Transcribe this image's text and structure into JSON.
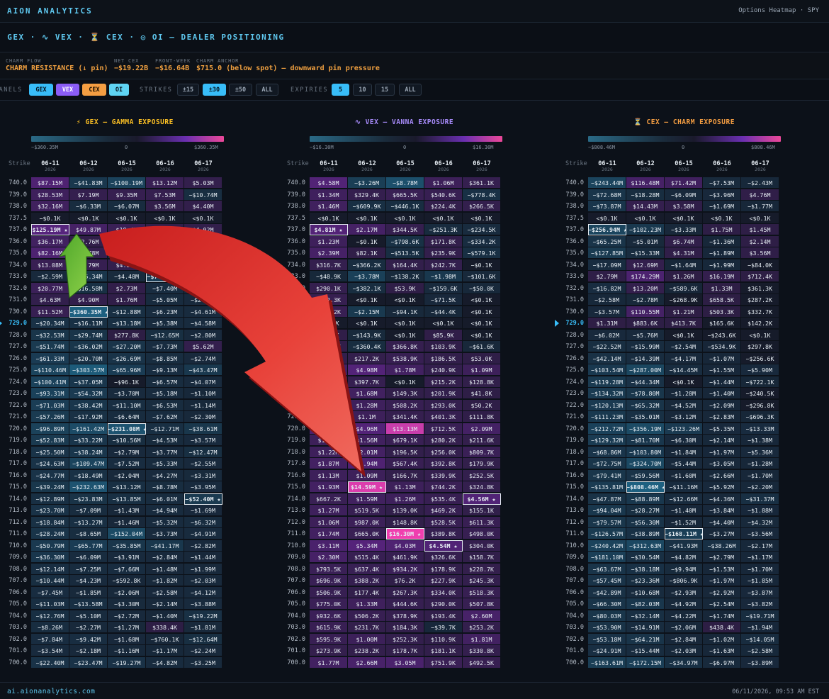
{
  "header": {
    "brand": "AION ANALYTICS",
    "right_label": "Options Heatmap · SPY"
  },
  "title": "⚡ GEX · ∿ VEX · ⏳ CEX · ◎ OI — DEALER POSITIONING",
  "stats": [
    {
      "label": "CHARM FLOW",
      "value": "CHARM RESISTANCE (↓ pin)"
    },
    {
      "label": "NET CEX",
      "value": "−$19.22B"
    },
    {
      "label": "FRONT-WEEK",
      "value": "−$16.64B"
    },
    {
      "label": "CHARM ANCHOR",
      "value": "$715.0 (below spot) — downward pin pressure"
    }
  ],
  "controls": {
    "panels_label": "PANELS",
    "panels": [
      "GEX",
      "VEX",
      "CEX",
      "OI"
    ],
    "strikes_label": "STRIKES",
    "strikes": [
      "±15",
      "±30",
      "±50",
      "ALL"
    ],
    "strikes_selected": "±30",
    "expiries_label": "EXPIRIES",
    "expiries": [
      "5",
      "10",
      "15",
      "ALL"
    ],
    "expiries_selected": "5"
  },
  "colors": {
    "accent": "#38bdf8",
    "gex_title": "#fbbf24",
    "vex_title": "#a78bfa",
    "cex_title": "#f59e42",
    "negative": "#2a5c78",
    "positive": "#7c2fbf",
    "extreme_positive": "#ec4899"
  },
  "dates": [
    {
      "d": "06-11",
      "y": "2026"
    },
    {
      "d": "06-12",
      "y": "2026"
    },
    {
      "d": "06-15",
      "y": "2026"
    },
    {
      "d": "06-16",
      "y": "2026"
    },
    {
      "d": "06-17",
      "y": "2026"
    }
  ],
  "strike_header": "Strike",
  "spot_strike": "729.0",
  "strikes": [
    "740.0",
    "739.0",
    "738.0",
    "737.5",
    "737.0",
    "736.0",
    "735.0",
    "734.0",
    "733.0",
    "732.0",
    "731.0",
    "730.0",
    "729.0",
    "728.0",
    "727.0",
    "726.0",
    "725.0",
    "724.0",
    "723.0",
    "722.0",
    "721.0",
    "720.0",
    "719.0",
    "718.0",
    "717.0",
    "716.0",
    "715.0",
    "714.0",
    "713.0",
    "712.0",
    "711.0",
    "710.0",
    "709.0",
    "708.0",
    "707.0",
    "706.0",
    "705.0",
    "704.0",
    "703.0",
    "702.0",
    "701.0",
    "700.0"
  ],
  "panels": [
    {
      "title": "⚡ GEX — GAMMA EXPOSURE",
      "scale_min": "−$360.35M",
      "scale_mid": "0",
      "scale_max": "$360.35M",
      "rows": [
        [
          "$87.15M",
          "−$41.83M",
          "−$100.19M",
          "$13.12M",
          "$5.03M"
        ],
        [
          "$28.53M",
          "$7.19M",
          "$9.35M",
          "$7.53M",
          "−$10.74M"
        ],
        [
          "$32.16M",
          "−$6.33M",
          "−$6.07M",
          "$3.56M",
          "$4.40M"
        ],
        [
          "−$0.1K",
          "<$0.1K",
          "<$0.1K",
          "<$0.1K",
          "<$0.1K"
        ],
        [
          "$125.19M ★",
          "$49.87M",
          "$18.4M",
          "$3.1M",
          "$4.02M"
        ],
        [
          "$36.17M",
          "$2.76M",
          "$1.2M",
          "−$2.4M",
          "$1.3M"
        ],
        [
          "$82.16M",
          "$7.78M",
          "−$10.66M",
          "$1.9M",
          "$3.1M"
        ],
        [
          "$13.08M",
          "$9.79M",
          "$4.81M",
          "$7.14M",
          "$2.2M"
        ],
        [
          "−$2.59M",
          "−$35.34M",
          "−$4.48M",
          "−$70.49M ★",
          "−$2.4M"
        ],
        [
          "$20.77M",
          "−$16.58M",
          "$2.73M",
          "−$7.40M",
          "−$2.1M"
        ],
        [
          "$4.63M",
          "$4.90M",
          "$1.76M",
          "−$5.05M",
          "−$2.52M"
        ],
        [
          "$11.52M",
          "−$360.35M ★",
          "−$12.88M",
          "−$6.23M",
          "−$4.61M"
        ],
        [
          "−$20.34M",
          "−$16.11M",
          "−$13.18M",
          "−$5.38M",
          "−$4.58M"
        ],
        [
          "−$32.53M",
          "−$29.74M",
          "$277.8K",
          "−$12.65M",
          "−$2.80M"
        ],
        [
          "−$51.74M",
          "−$36.02M",
          "−$27.20M",
          "−$7.73M",
          "$5.62M"
        ],
        [
          "−$61.33M",
          "−$20.70M",
          "−$26.69M",
          "−$8.85M",
          "−$2.74M"
        ],
        [
          "−$110.46M",
          "−$303.57M",
          "−$65.96M",
          "−$9.13M",
          "−$43.47M"
        ],
        [
          "−$100.41M",
          "−$37.05M",
          "−$96.1K",
          "−$6.57M",
          "−$4.07M"
        ],
        [
          "−$93.31M",
          "−$54.32M",
          "−$3.70M",
          "−$5.18M",
          "−$1.10M"
        ],
        [
          "−$71.03M",
          "−$38.42M",
          "−$11.10M",
          "−$6.53M",
          "−$1.14M"
        ],
        [
          "−$57.26M",
          "−$17.92M",
          "−$6.64M",
          "−$7.62M",
          "−$2.30M"
        ],
        [
          "−$96.89M",
          "−$161.42M",
          "−$231.08M ★",
          "−$12.71M",
          "−$38.61M"
        ],
        [
          "−$52.83M",
          "−$33.22M",
          "−$10.56M",
          "−$4.53M",
          "−$3.57M"
        ],
        [
          "−$25.50M",
          "−$38.24M",
          "−$2.79M",
          "−$3.77M",
          "−$12.47M"
        ],
        [
          "−$24.63M",
          "−$109.47M",
          "−$7.52M",
          "−$5.33M",
          "−$2.55M"
        ],
        [
          "−$24.77M",
          "−$18.49M",
          "−$2.04M",
          "−$4.27M",
          "−$3.31M"
        ],
        [
          "−$39.24M",
          "−$232.63M",
          "−$13.12M",
          "−$8.78M",
          "−$3.95M"
        ],
        [
          "−$12.89M",
          "−$23.83M",
          "−$13.85M",
          "−$6.01M",
          "−$52.40M ★"
        ],
        [
          "−$23.70M",
          "−$7.09M",
          "−$1.43M",
          "−$4.94M",
          "−$1.69M"
        ],
        [
          "−$18.84M",
          "−$13.27M",
          "−$1.46M",
          "−$5.32M",
          "−$6.32M"
        ],
        [
          "−$28.24M",
          "−$8.65M",
          "−$152.04M",
          "−$3.73M",
          "−$4.91M"
        ],
        [
          "−$50.79M",
          "−$65.77M",
          "−$35.85M",
          "−$41.17M",
          "−$2.82M"
        ],
        [
          "−$36.30M",
          "−$6.09M",
          "−$3.91M",
          "−$2.84M",
          "−$1.44M"
        ],
        [
          "−$12.14M",
          "−$7.25M",
          "−$7.66M",
          "−$1.48M",
          "−$1.99M"
        ],
        [
          "−$10.44M",
          "−$4.23M",
          "−$592.8K",
          "−$1.82M",
          "−$2.03M"
        ],
        [
          "−$7.45M",
          "−$1.85M",
          "−$2.06M",
          "−$2.58M",
          "−$4.12M"
        ],
        [
          "−$11.03M",
          "−$13.58M",
          "−$3.30M",
          "−$2.14M",
          "−$3.88M"
        ],
        [
          "−$12.76M",
          "−$5.10M",
          "−$2.72M",
          "−$1.40M",
          "−$19.22M"
        ],
        [
          "−$8.26M",
          "−$2.27M",
          "−$1.27M",
          "$338.4K",
          "−$1.81M"
        ],
        [
          "−$7.84M",
          "−$9.42M",
          "−$1.68M",
          "−$760.1K",
          "−$12.64M"
        ],
        [
          "−$3.54M",
          "−$2.18M",
          "−$1.16M",
          "−$1.17M",
          "−$2.24M"
        ],
        [
          "−$22.40M",
          "−$23.47M",
          "−$19.27M",
          "−$4.82M",
          "−$3.25M"
        ]
      ]
    },
    {
      "title": "∿ VEX — VANNA EXPOSURE",
      "scale_min": "−$16.30M",
      "scale_mid": "0",
      "scale_max": "$16.30M",
      "rows": [
        [
          "$4.58M",
          "−$3.26M",
          "−$8.78M",
          "$1.06M",
          "$361.1K"
        ],
        [
          "$1.34M",
          "$329.4K",
          "$665.5K",
          "$540.6K",
          "−$778.4K"
        ],
        [
          "$1.46M",
          "−$609.9K",
          "−$446.1K",
          "$224.4K",
          "$266.5K"
        ],
        [
          "<$0.1K",
          "<$0.1K",
          "<$0.1K",
          "<$0.1K",
          "<$0.1K"
        ],
        [
          "$4.81M ★",
          "$2.17M",
          "$344.5K",
          "−$251.3K",
          "−$234.5K"
        ],
        [
          "$1.23M",
          "−$0.1K",
          "−$798.6K",
          "$171.8K",
          "−$334.2K"
        ],
        [
          "$2.39M",
          "$82.1K",
          "−$513.5K",
          "$235.9K",
          "−$579.1K"
        ],
        [
          "$316.7K",
          "−$366.2K",
          "$164.4K",
          "$242.7K",
          "−$0.1K"
        ],
        [
          "−$48.9K",
          "−$3.78M",
          "−$138.2K",
          "−$1.98M",
          "−$101.6K"
        ],
        [
          "$290.1K",
          "−$382.1K",
          "$53.9K",
          "−$159.6K",
          "−$50.0K"
        ],
        [
          "$412.3K",
          "<$0.1K",
          "<$0.1K",
          "−$71.5K",
          "<$0.1K"
        ],
        [
          "$566.2K",
          "−$2.15M",
          "−$94.1K",
          "−$44.4K",
          "<$0.1K"
        ],
        [
          "<$0.1K",
          "<$0.1K",
          "<$0.1K",
          "<$0.1K",
          "<$0.1K"
        ],
        [
          "$88.1K",
          "−$143.9K",
          "<$0.1K",
          "$85.9K",
          "<$0.1K"
        ],
        [
          "$121.4K",
          "−$360.4K",
          "$366.8K",
          "$103.9K",
          "−$61.6K"
        ],
        [
          "$205.7K",
          "$217.2K",
          "$538.9K",
          "$186.5K",
          "$53.0K"
        ],
        [
          "$2.12M",
          "$4.98M",
          "$1.78M",
          "$240.9K",
          "$1.09M"
        ],
        [
          "$1.03M",
          "$397.7K",
          "<$0.1K",
          "$215.2K",
          "$128.8K"
        ],
        [
          "$1.25M",
          "$1.68M",
          "$149.3K",
          "$201.9K",
          "$41.8K"
        ],
        [
          "$1.14M",
          "$1.28M",
          "$508.2K",
          "$293.0K",
          "$50.2K"
        ],
        [
          "$864.2K",
          "$1.1M",
          "$341.4K",
          "$401.3K",
          "$111.8K"
        ],
        [
          "$3.04M",
          "$4.96M",
          "$13.13M",
          "$712.5K",
          "$2.09M"
        ],
        [
          "$1.06M",
          "$1.56M",
          "$679.1K",
          "$280.2K",
          "$211.6K"
        ],
        [
          "$1.22M",
          "$2.01M",
          "$196.5K",
          "$256.0K",
          "$809.7K"
        ],
        [
          "$1.87M",
          "$3.94M",
          "$567.4K",
          "$392.8K",
          "$179.9K"
        ],
        [
          "$1.13M",
          "$1.09M",
          "$166.7K",
          "$339.9K",
          "$252.5K"
        ],
        [
          "$1.93M",
          "$14.59M ★",
          "$1.13M",
          "$744.2K",
          "$324.8K"
        ],
        [
          "$667.2K",
          "$1.59M",
          "$1.26M",
          "$535.4K",
          "$4.56M ★"
        ],
        [
          "$1.27M",
          "$519.5K",
          "$139.0K",
          "$469.2K",
          "$155.1K"
        ],
        [
          "$1.06M",
          "$987.0K",
          "$148.8K",
          "$528.5K",
          "$611.3K"
        ],
        [
          "$1.74M",
          "$665.0K",
          "$16.30M ★",
          "$389.8K",
          "$498.0K"
        ],
        [
          "$3.11M",
          "$5.34M",
          "$4.03M",
          "$4.54M ★",
          "$304.0K"
        ],
        [
          "$2.30M",
          "$515.4K",
          "$461.9K",
          "$326.6K",
          "$158.7K"
        ],
        [
          "$793.5K",
          "$637.4K",
          "$934.2K",
          "$178.9K",
          "$228.7K"
        ],
        [
          "$696.9K",
          "$388.2K",
          "$76.2K",
          "$227.9K",
          "$245.3K"
        ],
        [
          "$506.9K",
          "$177.4K",
          "$267.3K",
          "$334.0K",
          "$518.3K"
        ],
        [
          "$775.0K",
          "$1.33M",
          "$444.6K",
          "$290.0K",
          "$507.8K"
        ],
        [
          "$932.6K",
          "$506.2K",
          "$378.9K",
          "$193.4K",
          "$2.60M"
        ],
        [
          "$615.9K",
          "$231.7K",
          "$184.3K",
          "−$39.7K",
          "$253.2K"
        ],
        [
          "$595.9K",
          "$1.00M",
          "$252.3K",
          "$110.9K",
          "$1.81M"
        ],
        [
          "$273.9K",
          "$238.2K",
          "$178.7K",
          "$181.1K",
          "$330.8K"
        ],
        [
          "$1.77M",
          "$2.66M",
          "$3.05M",
          "$751.9K",
          "$492.5K"
        ]
      ]
    },
    {
      "title": "⏳ CEX — CHARM EXPOSURE",
      "scale_min": "−$808.46M",
      "scale_mid": "0",
      "scale_max": "$808.46M",
      "rows": [
        [
          "−$243.44M",
          "$116.48M",
          "$71.42M",
          "−$7.53M",
          "−$2.43M"
        ],
        [
          "−$72.68M",
          "−$18.28M",
          "−$6.09M",
          "−$3.96M",
          "$4.76M"
        ],
        [
          "−$73.87M",
          "$14.43M",
          "$3.58M",
          "−$1.69M",
          "−$1.77M"
        ],
        [
          "<$0.1K",
          "<$0.1K",
          "<$0.1K",
          "<$0.1K",
          "<$0.1K"
        ],
        [
          "−$256.94M ★",
          "−$102.23M",
          "−$3.33M",
          "$1.75M",
          "$1.45M"
        ],
        [
          "−$65.25M",
          "−$5.01M",
          "$6.74M",
          "−$1.36M",
          "$2.14M"
        ],
        [
          "−$127.85M",
          "−$15.33M",
          "$4.31M",
          "−$1.89M",
          "$3.56M"
        ],
        [
          "−$17.09M",
          "$12.69M",
          "−$1.64M",
          "−$1.99M",
          "−$84.0K"
        ],
        [
          "$2.79M",
          "$174.29M",
          "$1.26M",
          "$16.19M",
          "$712.4K"
        ],
        [
          "−$16.82M",
          "$13.20M",
          "−$589.6K",
          "$1.33M",
          "$361.3K"
        ],
        [
          "−$2.58M",
          "−$2.78M",
          "−$268.9K",
          "$658.5K",
          "$287.2K"
        ],
        [
          "−$3.57M",
          "$110.55M",
          "$1.21M",
          "$503.3K",
          "$332.7K"
        ],
        [
          "$1.31M",
          "$883.6K",
          "$413.7K",
          "$165.6K",
          "$142.2K"
        ],
        [
          "−$6.02M",
          "−$5.76M",
          "<$0.1K",
          "−$243.6K",
          "<$0.1K"
        ],
        [
          "−$22.52M",
          "−$15.99M",
          "−$2.54M",
          "−$534.9K",
          "$297.8K"
        ],
        [
          "−$42.14M",
          "−$14.39M",
          "−$4.17M",
          "−$1.07M",
          "−$256.6K"
        ],
        [
          "−$103.54M",
          "−$287.00M",
          "−$14.45M",
          "−$1.55M",
          "−$5.90M"
        ],
        [
          "−$119.28M",
          "−$44.34M",
          "<$0.1K",
          "−$1.44M",
          "−$722.1K"
        ],
        [
          "−$134.32M",
          "−$78.80M",
          "−$1.28M",
          "−$1.40M",
          "−$240.5K"
        ],
        [
          "−$120.13M",
          "−$65.32M",
          "−$4.52M",
          "−$2.09M",
          "−$296.8K"
        ],
        [
          "−$111.23M",
          "−$35.01M",
          "−$3.12M",
          "−$2.83M",
          "−$696.3K"
        ],
        [
          "−$212.72M",
          "−$356.19M",
          "−$123.26M",
          "−$5.35M",
          "−$13.33M"
        ],
        [
          "−$129.32M",
          "−$81.70M",
          "−$6.30M",
          "−$2.14M",
          "−$1.38M"
        ],
        [
          "−$68.86M",
          "−$103.80M",
          "−$1.84M",
          "−$1.97M",
          "−$5.36M"
        ],
        [
          "−$72.75M",
          "−$324.70M",
          "−$5.44M",
          "−$3.05M",
          "−$1.28M"
        ],
        [
          "−$79.41M",
          "−$59.56M",
          "−$1.60M",
          "−$2.66M",
          "−$1.70M"
        ],
        [
          "−$135.81M",
          "−$808.46M ★",
          "−$11.16M",
          "−$5.92M",
          "−$2.20M"
        ],
        [
          "−$47.87M",
          "−$88.89M",
          "−$12.66M",
          "−$4.36M",
          "−$31.37M"
        ],
        [
          "−$94.04M",
          "−$28.27M",
          "−$1.40M",
          "−$3.84M",
          "−$1.88M"
        ],
        [
          "−$79.57M",
          "−$56.30M",
          "−$1.52M",
          "−$4.40M",
          "−$4.32M"
        ],
        [
          "−$126.57M",
          "−$38.89M",
          "−$168.11M ★",
          "−$3.27M",
          "−$3.56M"
        ],
        [
          "−$240.42M",
          "−$312.63M",
          "−$41.93M",
          "−$38.26M",
          "−$2.17M"
        ],
        [
          "−$181.10M",
          "−$30.54M",
          "−$4.82M",
          "−$2.79M",
          "−$1.17M"
        ],
        [
          "−$63.67M",
          "−$38.18M",
          "−$9.94M",
          "−$1.53M",
          "−$1.70M"
        ],
        [
          "−$57.45M",
          "−$23.36M",
          "−$806.9K",
          "−$1.97M",
          "−$1.85M"
        ],
        [
          "−$42.89M",
          "−$10.68M",
          "−$2.93M",
          "−$2.92M",
          "−$3.87M"
        ],
        [
          "−$66.30M",
          "−$82.03M",
          "−$4.92M",
          "−$2.54M",
          "−$3.82M"
        ],
        [
          "−$80.03M",
          "−$32.14M",
          "−$4.22M",
          "−$1.74M",
          "−$19.71M"
        ],
        [
          "−$53.90M",
          "−$14.91M",
          "−$2.06M",
          "$438.4K",
          "−$1.94M"
        ],
        [
          "−$53.18M",
          "−$64.21M",
          "−$2.84M",
          "−$1.02M",
          "−$14.05M"
        ],
        [
          "−$24.91M",
          "−$15.44M",
          "−$2.03M",
          "−$1.63M",
          "−$2.58M"
        ],
        [
          "−$163.61M",
          "−$172.15M",
          "−$34.97M",
          "−$6.97M",
          "−$3.89M"
        ]
      ]
    }
  ],
  "footer": {
    "link": "ai.aionanalytics.com",
    "timestamp": "06/11/2026, 09:53 AM EST"
  }
}
